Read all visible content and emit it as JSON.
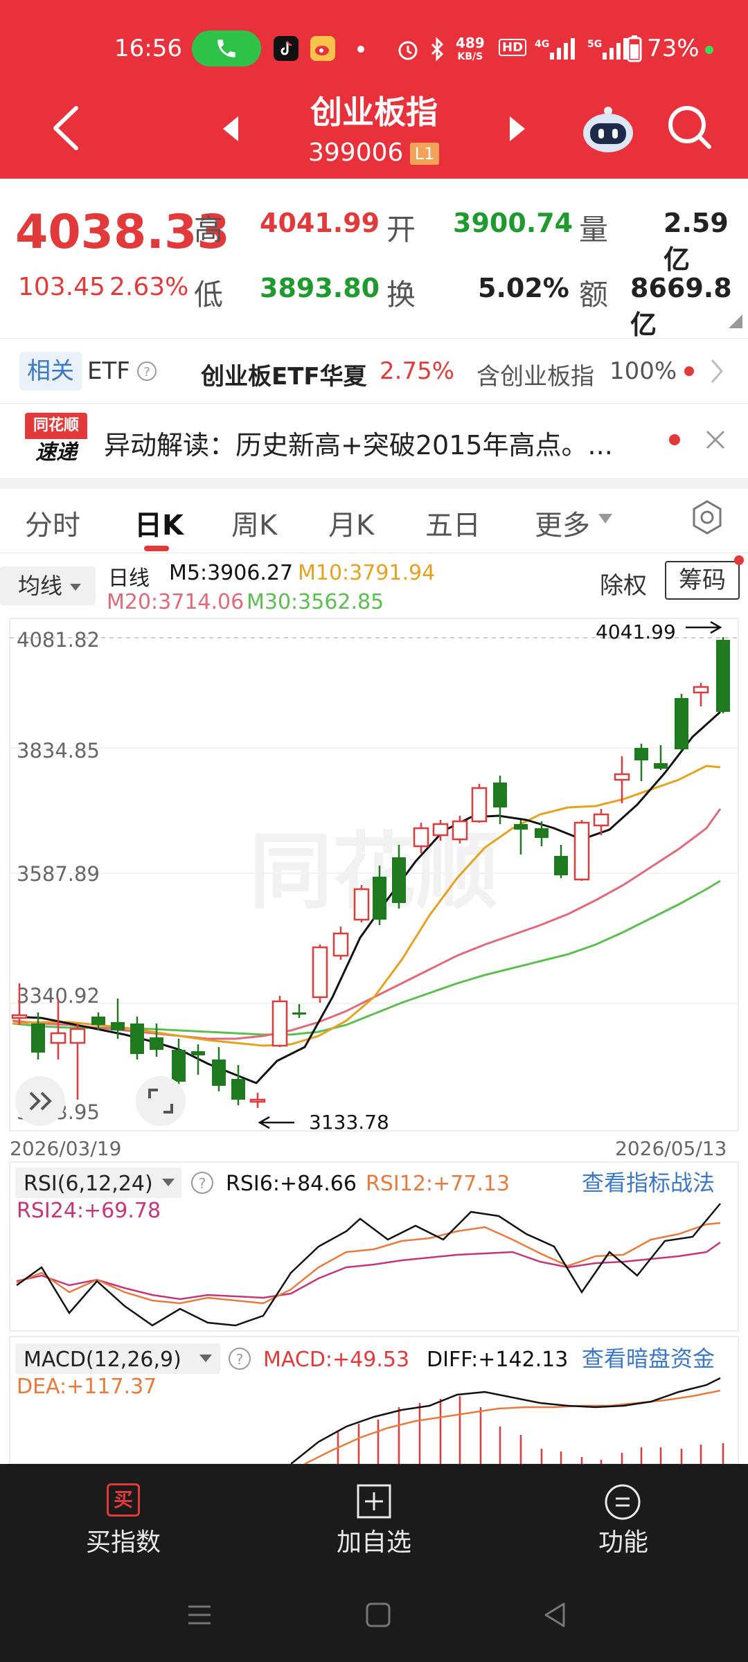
{
  "status_bar": {
    "time": "16:56",
    "net_speed_top": "489",
    "net_speed_bottom": "KB/S",
    "battery": "73%"
  },
  "header": {
    "title": "创业板指",
    "code": "399006",
    "level_badge": "L1"
  },
  "quote": {
    "price": "4038.33",
    "change": "103.45",
    "change_pct": "2.63%",
    "high_label": "高",
    "high": "4041.99",
    "low_label": "低",
    "low": "3893.80",
    "open_label": "开",
    "open": "3900.74",
    "turnover_label": "换",
    "turnover": "5.02%",
    "volume_label": "量",
    "volume": "2.59亿",
    "amount_label": "额",
    "amount": "8669.8亿"
  },
  "etf_row": {
    "tag": "相关",
    "etf": "ETF",
    "name": "创业板ETF华夏",
    "pct": "2.75%",
    "contains": "含创业板指",
    "contains_pct": "100%"
  },
  "news": {
    "logo_top": "同花顺",
    "logo_bottom": "速递",
    "text": "异动解读：历史新高+突破2015年高点。..."
  },
  "tabs": [
    "分时",
    "日K",
    "周K",
    "月K",
    "五日",
    "更多"
  ],
  "ma_row": {
    "ma_button": "均线",
    "kind": "日线",
    "m5": "M5:3906.27",
    "m10": "M10:3791.94",
    "m20": "M20:3714.06",
    "m30": "M30:3562.85",
    "ex_rights": "除权",
    "chips": "筹码"
  },
  "chart_data": {
    "type": "candlestick",
    "y_ticks": [
      "4081.82",
      "3834.85",
      "3587.89",
      "3340.92",
      "3093.95"
    ],
    "x_start": "2026/03/19",
    "x_end": "2026/05/13",
    "max_label": "4041.99",
    "min_label": "3133.78",
    "colors": {
      "up": "#e23a3a",
      "down": "#1f7a1f",
      "m5": "#111111",
      "m10": "#e6a11e",
      "m20": "#e06a7a",
      "m30": "#5bbf4f"
    }
  },
  "rsi": {
    "label": "RSI(6,12,24)",
    "rsi6": "RSI6:+84.66",
    "rsi12": "RSI12:+77.13",
    "rsi24": "RSI24:+69.78",
    "link": "查看指标战法"
  },
  "macd": {
    "label": "MACD(12,26,9)",
    "macd": "MACD:+49.53",
    "diff": "DIFF:+142.13",
    "dea": "DEA:+117.37",
    "link": "查看暗盘资金"
  },
  "bottom_nav": [
    {
      "label": "买指数",
      "icon": "buy-icon",
      "icon_text": "买"
    },
    {
      "label": "加自选",
      "icon": "add-icon"
    },
    {
      "label": "功能",
      "icon": "menu-icon"
    }
  ]
}
